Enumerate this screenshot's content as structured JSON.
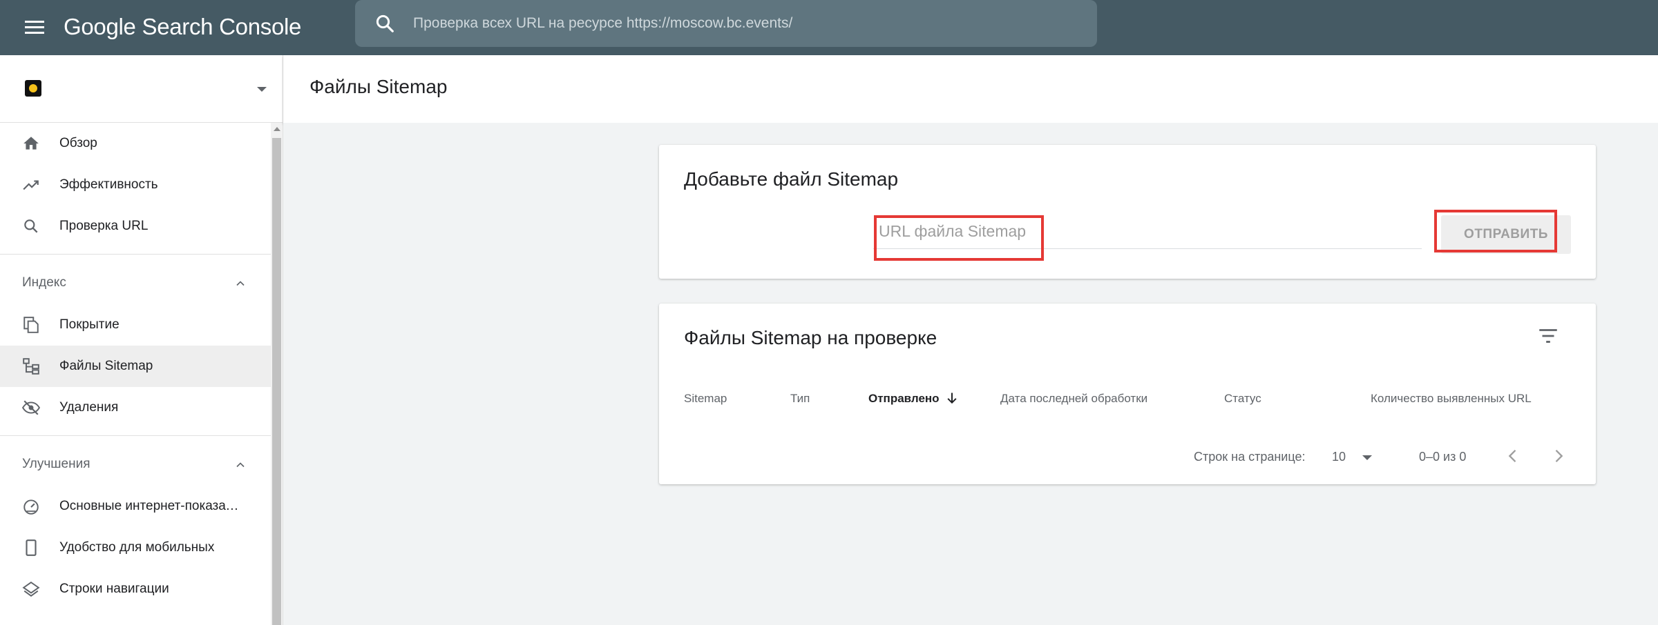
{
  "topbar": {
    "logo_text": "Google Search Console",
    "search_placeholder": "Проверка всех URL на ресурсе https://moscow.bc.events/"
  },
  "sidebar": {
    "primary": [
      {
        "label": "Обзор",
        "icon": "home-icon"
      },
      {
        "label": "Эффективность",
        "icon": "trending-up-icon"
      },
      {
        "label": "Проверка URL",
        "icon": "search-icon"
      }
    ],
    "index_section": {
      "label": "Индекс",
      "items": [
        {
          "label": "Покрытие",
          "icon": "pages-icon"
        },
        {
          "label": "Файлы Sitemap",
          "icon": "sitemap-icon",
          "active": true
        },
        {
          "label": "Удаления",
          "icon": "visibility-off-icon"
        }
      ]
    },
    "improvements_section": {
      "label": "Улучшения",
      "items": [
        {
          "label": "Основные интернет-показатели",
          "icon": "speed-gauge-icon"
        },
        {
          "label": "Удобство для мобильных",
          "icon": "smartphone-icon"
        },
        {
          "label": "Строки навигации",
          "icon": "layers-icon"
        }
      ]
    }
  },
  "page": {
    "title": "Файлы Sitemap"
  },
  "add_card": {
    "title": "Добавьте файл Sitemap",
    "url_placeholder": "URL файла Sitemap",
    "submit_label": "ОТПРАВИТЬ"
  },
  "list_card": {
    "title": "Файлы Sitemap на проверке",
    "columns": {
      "sitemap": "Sitemap",
      "type": "Тип",
      "submitted": "Отправлено",
      "last_read": "Дата последней обработки",
      "status": "Статус",
      "discovered": "Количество выявленных URL"
    },
    "pagination": {
      "rows_label": "Строк на странице:",
      "rows_value": "10",
      "range": "0–0 из 0"
    }
  },
  "colors": {
    "topbar": "#455a64",
    "highlight": "#e53935"
  }
}
